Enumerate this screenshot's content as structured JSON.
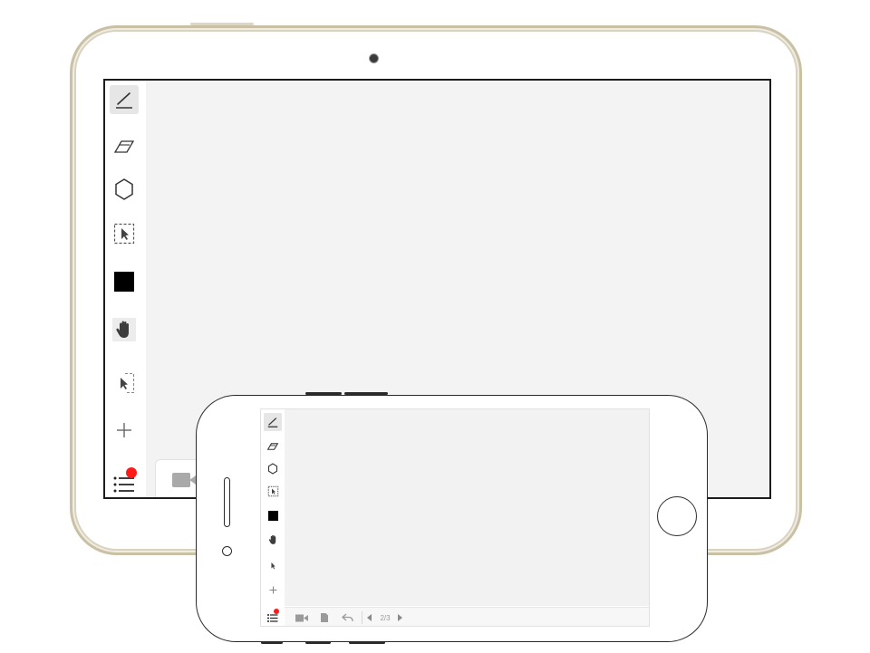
{
  "phone_bottom_bar": {
    "page_indicator": "2/3"
  },
  "colors": {
    "accent_notification": "#ff1a1a",
    "tablet_frame": "#c9c0a6",
    "canvas_bg": "#f3f3f3",
    "toolbar_icon": "#333333"
  },
  "tablet_toolbar": {
    "tools": [
      "pen-icon",
      "eraser-icon",
      "hexagon-icon",
      "select-area-icon",
      "color-swatch",
      "hand-icon",
      "pointer-icon",
      "plus-icon",
      "list-menu-icon"
    ],
    "active_tool": "pen-icon"
  },
  "phone_toolbar": {
    "tools": [
      "pen-icon",
      "eraser-icon",
      "hexagon-icon",
      "select-area-icon",
      "color-swatch",
      "hand-icon",
      "pointer-icon",
      "plus-icon",
      "list-menu-icon"
    ],
    "active_tool": "pen-icon"
  }
}
